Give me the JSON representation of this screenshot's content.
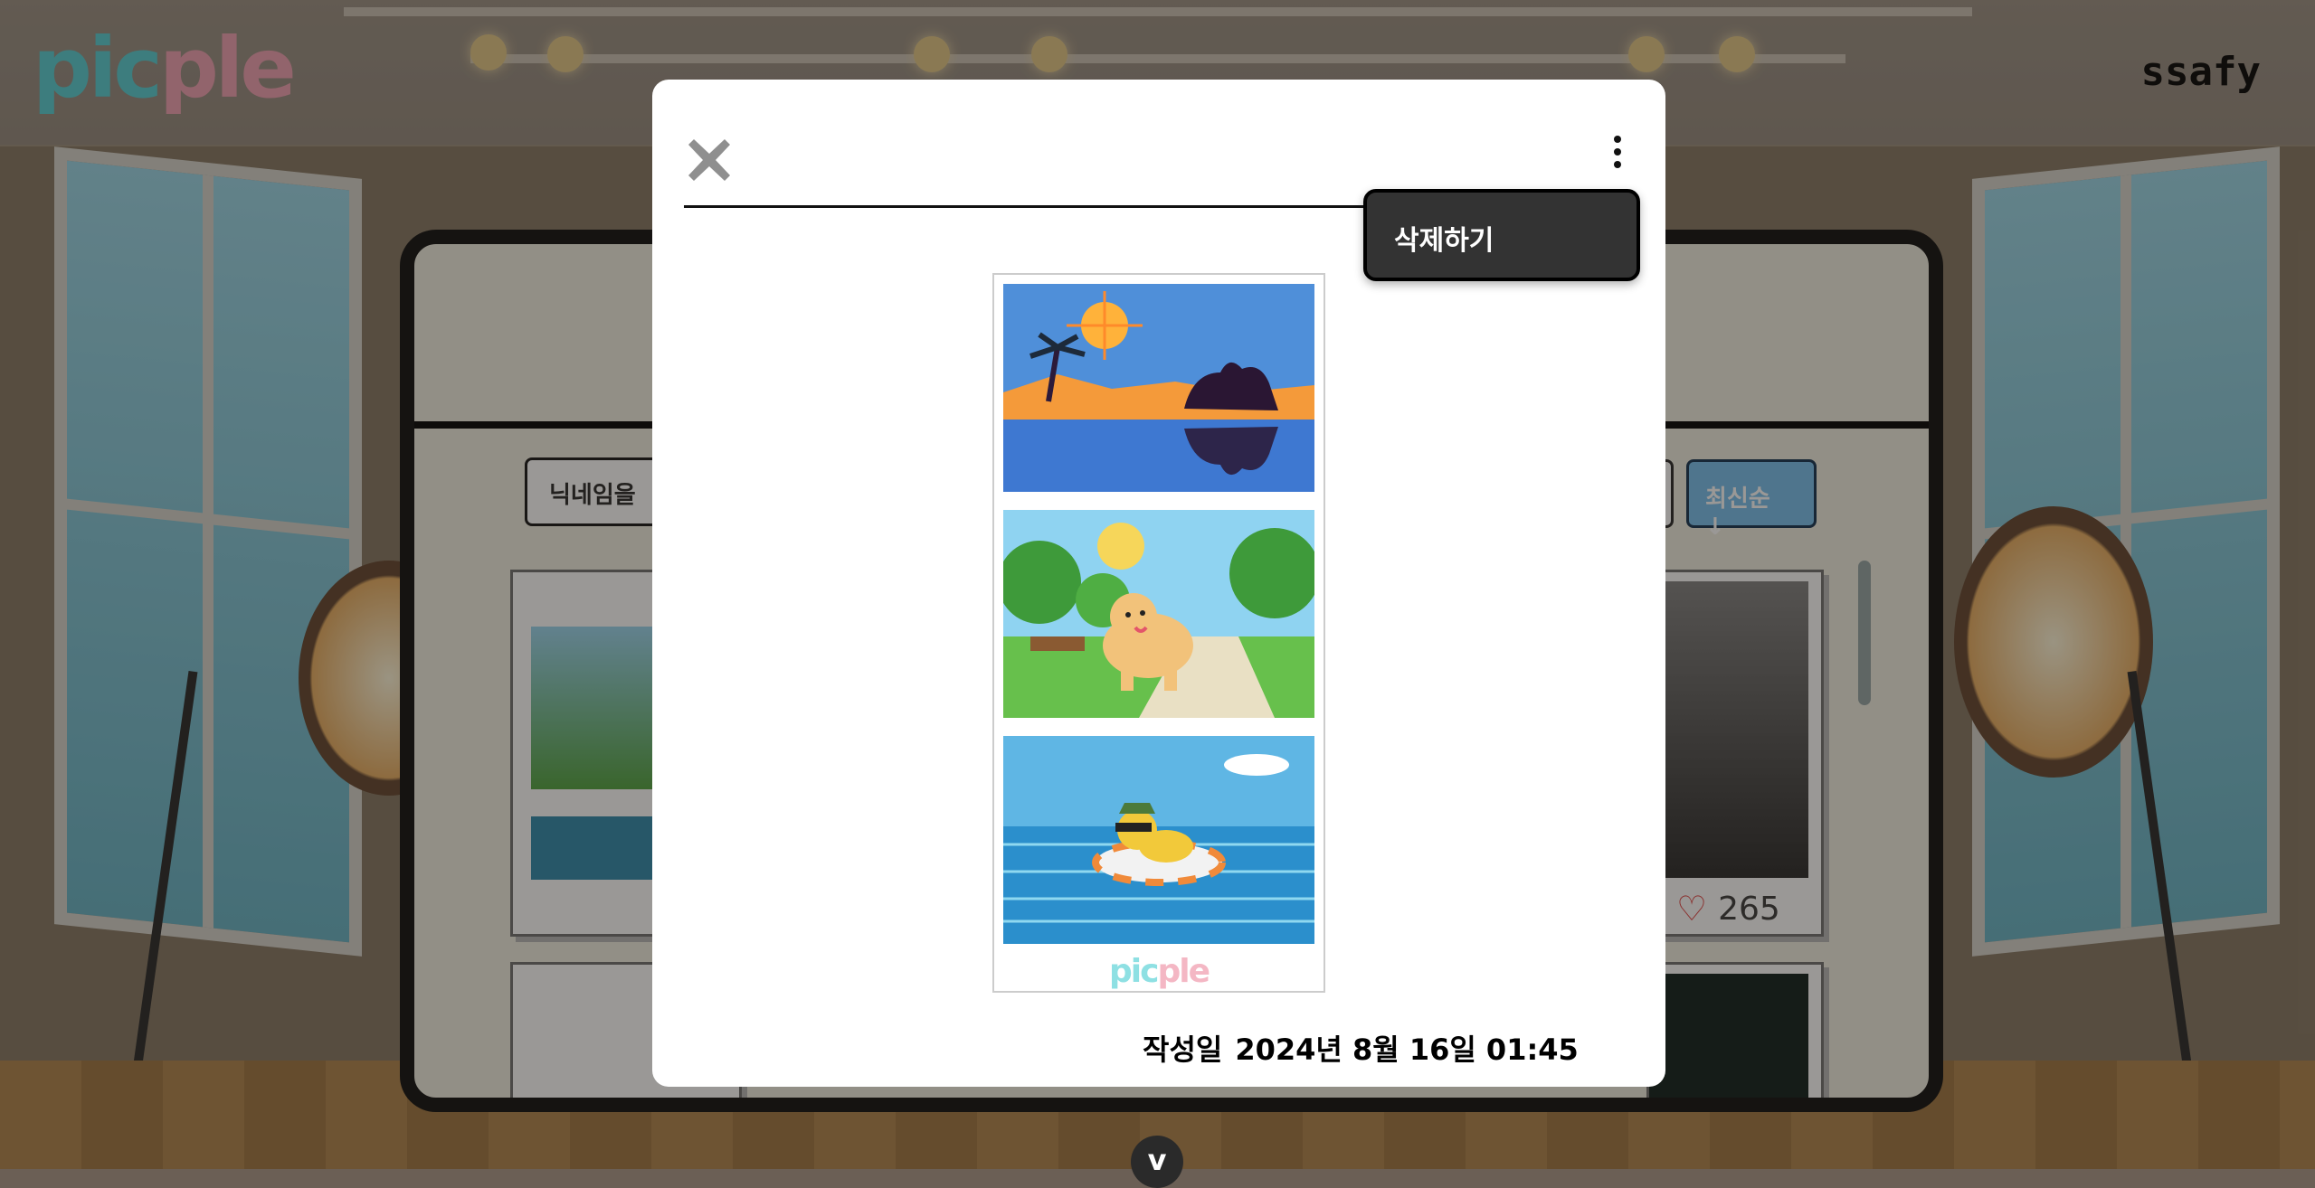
{
  "header": {
    "logo_pic": "pic",
    "logo_ple": "ple",
    "user_name": "ssafy"
  },
  "gallery": {
    "nickname_placeholder": "닉네임을",
    "sort_label": "최신순 ↓",
    "cards": [
      {
        "likes": "265"
      }
    ]
  },
  "modal": {
    "menu": {
      "delete_label": "삭제하기"
    },
    "created_label": "작성일",
    "created_date": "2024년 8월 16일 01:45",
    "strip_logo_pic": "pic",
    "strip_logo_ple": "ple",
    "frames": [
      "desert-camel-oasis",
      "golden-retriever-park",
      "duck-on-float-sea"
    ]
  },
  "icons": {
    "close": "close-icon",
    "kebab": "more-vert-icon",
    "heart": "heart-icon",
    "chevron": "chevron-down-icon"
  },
  "colors": {
    "sort_button": "#7ec3ef",
    "dropdown_bg": "#333333",
    "logo_cyan": "#5fd1d6",
    "logo_pink": "#f1a6b7"
  }
}
